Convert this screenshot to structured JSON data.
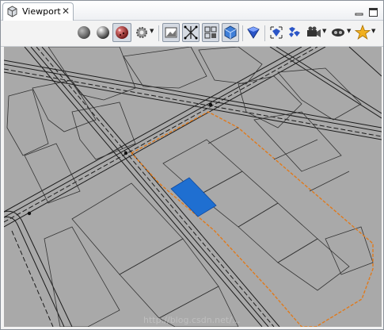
{
  "tab": {
    "title": "Viewport",
    "close_icon": "close-icon",
    "view_icon": "cube-icon"
  },
  "window_controls": {
    "minimize_icon": "minimize-icon",
    "maximize_icon": "maximize-icon"
  },
  "toolbar": {
    "items": [
      {
        "name": "shading-gray-sphere-icon"
      },
      {
        "name": "shading-shiny-sphere-icon"
      },
      {
        "name": "shading-textured-sphere-icon",
        "pressed": true
      },
      {
        "name": "lighting-gear-icon",
        "dropdown": true
      },
      {
        "name": "wireframe-toggle-icon",
        "pressed": true
      },
      {
        "name": "edges-toggle-icon",
        "pressed": true
      },
      {
        "name": "grid-toggle-icon",
        "pressed": true
      },
      {
        "name": "cube-toggle-icon",
        "pressed": true
      },
      {
        "name": "selection-mode-icon"
      },
      {
        "name": "frame-selection-icon"
      },
      {
        "name": "bookmark-icon"
      },
      {
        "name": "camera-icon",
        "dropdown": true
      },
      {
        "name": "navigation-icon",
        "dropdown": true
      },
      {
        "name": "favorite-star-icon",
        "dropdown": true
      }
    ]
  },
  "viewport": {
    "background_color": "#a9a9a9",
    "selection_color": "#e07a1c",
    "selected_lot_color": "#1f6fd1",
    "watermark": "http://blog.csdn.net/..."
  }
}
